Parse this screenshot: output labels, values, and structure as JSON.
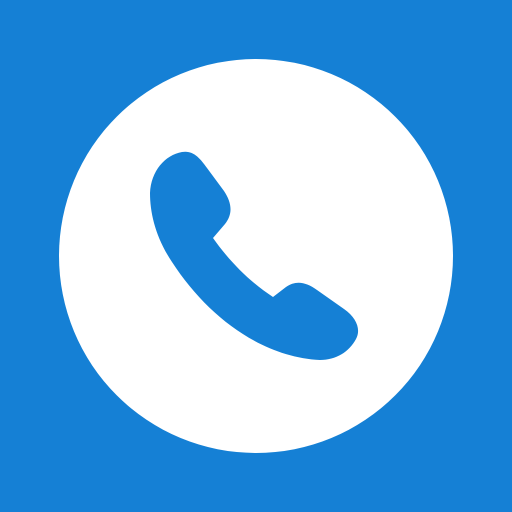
{
  "app_icon": {
    "icon_name": "phone-call-icon",
    "colors": {
      "background": "#1580D5",
      "circle": "#FFFFFF",
      "handset": "#1580D5"
    }
  }
}
